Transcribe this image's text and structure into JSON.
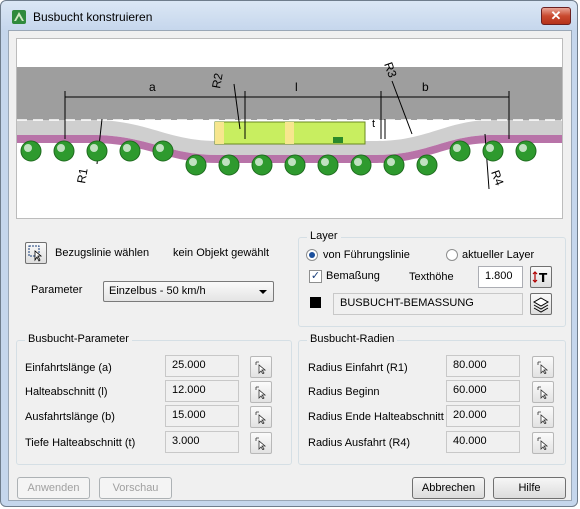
{
  "window": {
    "title": "Busbucht konstruieren",
    "close_glyph": "✕"
  },
  "preview": {
    "labels": {
      "a": "a",
      "l": "l",
      "b": "b",
      "t": "t",
      "r1": "R1",
      "r2": "R2",
      "r3": "R3",
      "r4": "R4"
    },
    "colors": {
      "road": "#a0a0a0",
      "curb": "#b873a8",
      "tree": "#2e9a2e",
      "bus": "#c8ee60"
    }
  },
  "reference": {
    "select_icon": "select-reference-icon",
    "label": "Bezugslinie wählen",
    "status": "kein Objekt gewählt"
  },
  "parameter": {
    "label": "Parameter",
    "value": "Einzelbus - 50 km/h"
  },
  "layer": {
    "title": "Layer",
    "option_guide": "von Führungslinie",
    "option_current": "aktueller Layer",
    "selected": "von Führungslinie",
    "dimension_label": "Bemaßung",
    "dimension_checked": true,
    "text_height_label": "Texthöhe",
    "text_height_value": "1.800",
    "layer_name": "BUSBUCHT-BEMASSUNG",
    "layer_color": "#000000"
  },
  "bay_params": {
    "title": "Busbucht-Parameter",
    "rows": [
      {
        "label": "Einfahrtslänge (a)",
        "value": "25.000"
      },
      {
        "label": "Halteabschnitt (l)",
        "value": "12.000"
      },
      {
        "label": "Ausfahrtslänge (b)",
        "value": "15.000"
      },
      {
        "label": "Tiefe Halteabschnitt (t)",
        "value": "3.000"
      }
    ]
  },
  "radii": {
    "title": "Busbucht-Radien",
    "rows": [
      {
        "label": "Radius Einfahrt (R1)",
        "value": "80.000"
      },
      {
        "label": "Radius Beginn",
        "value": "60.000"
      },
      {
        "label": "Radius Ende Halteabschnitt",
        "value": "20.000"
      },
      {
        "label": "Radius Ausfahrt (R4)",
        "value": "40.000"
      }
    ]
  },
  "buttons": {
    "apply": "Anwenden",
    "preview": "Vorschau",
    "cancel": "Abbrechen",
    "help": "Hilfe"
  }
}
